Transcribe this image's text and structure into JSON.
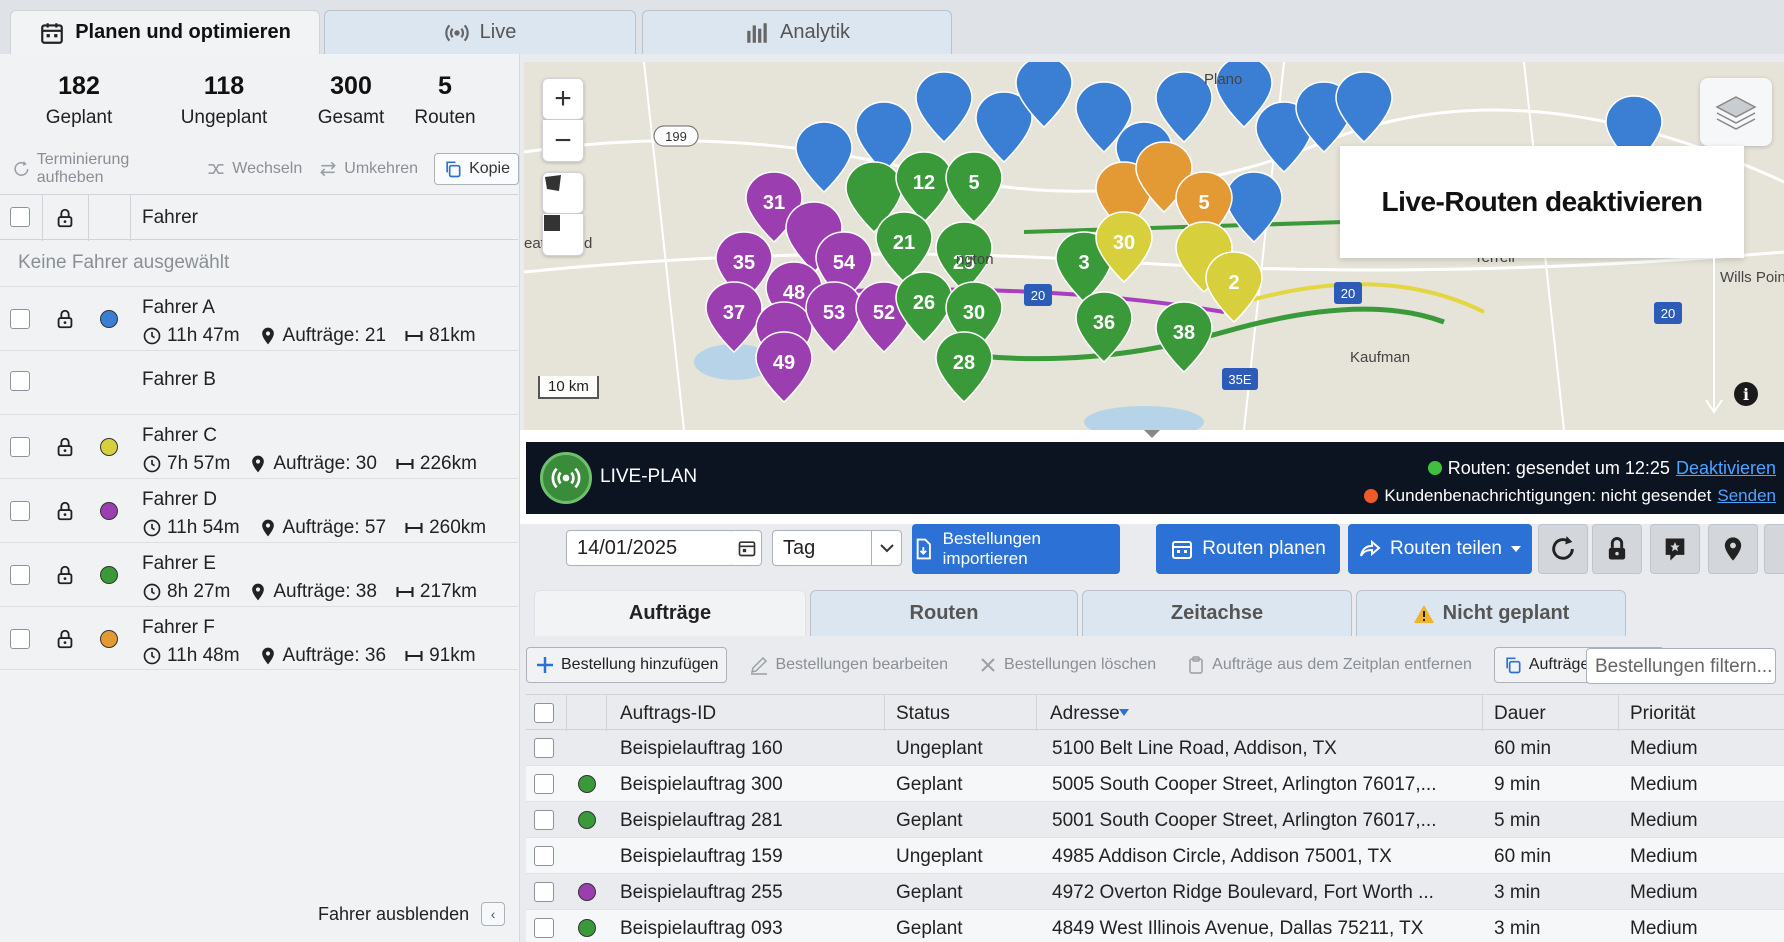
{
  "top_tabs": [
    {
      "label": "Planen und optimieren",
      "icon": "calendar-icon"
    },
    {
      "label": "Live",
      "icon": "broadcast-icon"
    },
    {
      "label": "Analytik",
      "icon": "bar-chart-icon"
    }
  ],
  "stats": [
    {
      "value": "182",
      "label": "Geplant"
    },
    {
      "value": "118",
      "label": "Ungeplant"
    },
    {
      "value": "300",
      "label": "Gesamt"
    },
    {
      "value": "5",
      "label": "Routen"
    }
  ],
  "actions": {
    "unschedule": "Terminierung aufheben",
    "swap": "Wechseln",
    "reverse": "Umkehren",
    "copy": "Kopie"
  },
  "drivers_header": "Fahrer",
  "no_drivers": "Keine Fahrer ausgewählt",
  "drivers": [
    {
      "name": "Fahrer A",
      "color": "#3b7fd4",
      "time": "11h 47m",
      "orders": "Aufträge: 21",
      "distance": "81km"
    },
    {
      "name": "Fahrer B",
      "color": "",
      "time": "",
      "orders": "",
      "distance": ""
    },
    {
      "name": "Fahrer C",
      "color": "#d8cf3c",
      "time": "7h 57m",
      "orders": "Aufträge: 30",
      "distance": "226km"
    },
    {
      "name": "Fahrer D",
      "color": "#9b3fb0",
      "time": "11h 54m",
      "orders": "Aufträge: 57",
      "distance": "260km"
    },
    {
      "name": "Fahrer E",
      "color": "#3a9a3a",
      "time": "8h 27m",
      "orders": "Aufträge: 38",
      "distance": "217km"
    },
    {
      "name": "Fahrer F",
      "color": "#e39a34",
      "time": "11h 48m",
      "orders": "Aufträge: 36",
      "distance": "91km"
    }
  ],
  "hide_drivers": "Fahrer ausblenden",
  "map": {
    "scale": "10 km",
    "callout": "Live-Routen deaktivieren",
    "places": [
      "Plano",
      "eatherford",
      "Terrell",
      "Wills Poin",
      "Kaufman",
      "ngton"
    ],
    "highways": [
      "199",
      "20",
      "20",
      "20",
      "35E"
    ]
  },
  "live": {
    "label": "LIVE-PLAN",
    "routes_status": "Routen: gesendet um 12:25",
    "routes_link": "Deaktivieren",
    "notify_status": "Kundenbenachrichtigungen: nicht gesendet",
    "notify_link": "Senden",
    "routes_dot": "#3fbf3f",
    "notify_dot": "#f05a28"
  },
  "toolbar": {
    "date": "14/01/2025",
    "period": "Tag",
    "import": "Bestellungen importieren",
    "plan": "Routen planen",
    "share": "Routen teilen"
  },
  "sub_tabs": [
    "Aufträge",
    "Routen",
    "Zeitachse",
    "Nicht geplant"
  ],
  "order_actions": {
    "add": "Bestellung hinzufügen",
    "edit": "Bestellungen bearbeiten",
    "delete": "Bestellungen löschen",
    "remove": "Aufträge aus dem Zeitplan entfernen",
    "copy": "Aufträge kopieren",
    "filter_placeholder": "Bestellungen filtern..."
  },
  "order_columns": [
    "Auftrags-ID",
    "Status",
    "Adresse",
    "Dauer",
    "Priorität"
  ],
  "orders": [
    {
      "id": "Beispielauftrag 160",
      "color": "",
      "status": "Ungeplant",
      "address": "5100 Belt Line Road, Addison, TX",
      "duration": "60 min",
      "priority": "Medium"
    },
    {
      "id": "Beispielauftrag 300",
      "color": "#3a9a3a",
      "status": "Geplant",
      "address": "5005 South Cooper Street, Arlington 76017,...",
      "duration": "9 min",
      "priority": "Medium"
    },
    {
      "id": "Beispielauftrag 281",
      "color": "#3a9a3a",
      "status": "Geplant",
      "address": "5001 South Cooper Street, Arlington 76017,...",
      "duration": "5 min",
      "priority": "Medium"
    },
    {
      "id": "Beispielauftrag 159",
      "color": "",
      "status": "Ungeplant",
      "address": "4985 Addison Circle, Addison 75001, TX",
      "duration": "60 min",
      "priority": "Medium"
    },
    {
      "id": "Beispielauftrag 255",
      "color": "#9b3fb0",
      "status": "Geplant",
      "address": "4972 Overton Ridge Boulevard, Fort Worth ...",
      "duration": "3 min",
      "priority": "Medium"
    },
    {
      "id": "Beispielauftrag 093",
      "color": "#3a9a3a",
      "status": "Geplant",
      "address": "4849 West Illinois Avenue, Dallas 75211, TX",
      "duration": "3 min",
      "priority": "Medium"
    }
  ]
}
